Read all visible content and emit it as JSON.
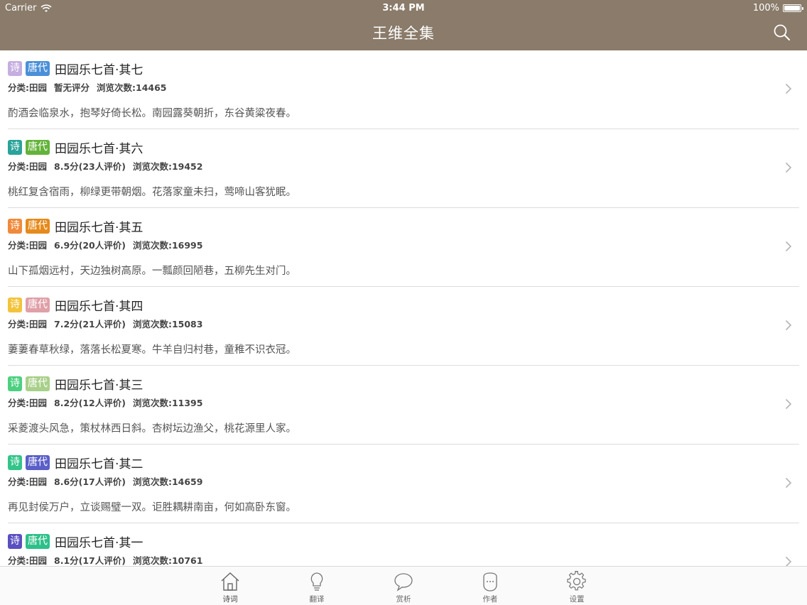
{
  "status": {
    "carrier": "Carrier",
    "time": "3:44 PM",
    "battery": "100%",
    "battery_level": 1.0
  },
  "nav": {
    "title": "王维全集"
  },
  "colors": {
    "bar": "#8a7b6a"
  },
  "poems": [
    {
      "type_tag": "诗",
      "type_color": "#c5aee0",
      "era_tag": "唐代",
      "era_color": "#4a90d9",
      "title": "田园乐七首·其七",
      "category": "分类:田园",
      "rating": "暂无评分",
      "views": "浏览次数:14465",
      "excerpt": "酌酒会临泉水，抱琴好倚长松。南园露葵朝折，东谷黄粱夜春。"
    },
    {
      "type_tag": "诗",
      "type_color": "#2aa39a",
      "era_tag": "唐代",
      "era_color": "#63b33a",
      "title": "田园乐七首·其六",
      "category": "分类:田园",
      "rating": "8.5分(23人评价)",
      "views": "浏览次数:19452",
      "excerpt": "桃红复含宿雨，柳绿更带朝烟。花落家童未扫，莺啼山客犹眠。"
    },
    {
      "type_tag": "诗",
      "type_color": "#f08a3a",
      "era_tag": "唐代",
      "era_color": "#e58a1c",
      "title": "田园乐七首·其五",
      "category": "分类:田园",
      "rating": "6.9分(20人评价)",
      "views": "浏览次数:16995",
      "excerpt": "山下孤烟远村，天边独树高原。一瓢颜回陋巷，五柳先生对门。"
    },
    {
      "type_tag": "诗",
      "type_color": "#f3c33a",
      "era_tag": "唐代",
      "era_color": "#e0a0a8",
      "title": "田园乐七首·其四",
      "category": "分类:田园",
      "rating": "7.2分(21人评价)",
      "views": "浏览次数:15083",
      "excerpt": "萋萋春草秋绿，落落长松夏寒。牛羊自归村巷，童稚不识衣冠。"
    },
    {
      "type_tag": "诗",
      "type_color": "#4cd080",
      "era_tag": "唐代",
      "era_color": "#a9d08a",
      "title": "田园乐七首·其三",
      "category": "分类:田园",
      "rating": "8.2分(12人评价)",
      "views": "浏览次数:11395",
      "excerpt": "采菱渡头风急，策杖林西日斜。杏树坛边渔父，桃花源里人家。"
    },
    {
      "type_tag": "诗",
      "type_color": "#34c48a",
      "era_tag": "唐代",
      "era_color": "#5a5fc8",
      "title": "田园乐七首·其二",
      "category": "分类:田园",
      "rating": "8.6分(17人评价)",
      "views": "浏览次数:14659",
      "excerpt": "再见封侯万户，立谈赐璧一双。讵胜耦耕南亩，何如高卧东窗。"
    },
    {
      "type_tag": "诗",
      "type_color": "#5a4fc0",
      "era_tag": "唐代",
      "era_color": "#2ec08a",
      "title": "田园乐七首·其一",
      "category": "分类:田园",
      "rating": "8.1分(17人评价)",
      "views": "浏览次数:10761",
      "excerpt": ""
    }
  ],
  "tabs": [
    {
      "label": "诗词",
      "icon": "home-icon"
    },
    {
      "label": "翻译",
      "icon": "lightbulb-icon"
    },
    {
      "label": "赏析",
      "icon": "speech-bubble-icon"
    },
    {
      "label": "作者",
      "icon": "person-face-icon"
    },
    {
      "label": "设置",
      "icon": "gear-icon"
    }
  ]
}
